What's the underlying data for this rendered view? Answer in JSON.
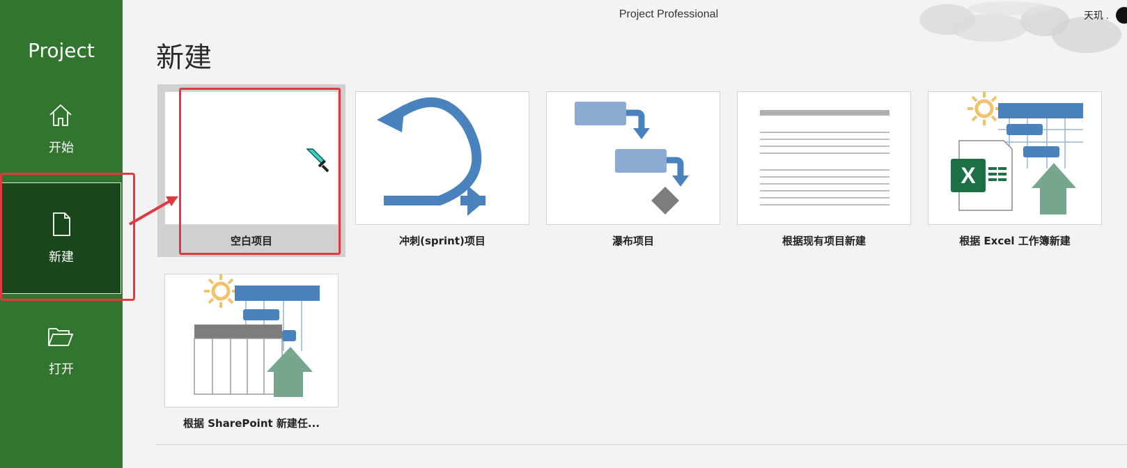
{
  "app": {
    "name": "Project",
    "window_title": "Project Professional",
    "user": "天玑 ."
  },
  "sidebar": {
    "items": [
      {
        "label": "开始",
        "icon": "home-icon"
      },
      {
        "label": "新建",
        "icon": "new-document-icon",
        "selected": true
      },
      {
        "label": "打开",
        "icon": "open-folder-icon"
      }
    ]
  },
  "page": {
    "title": "新建"
  },
  "templates": [
    {
      "label": "空白项目",
      "thumb": "blank",
      "selected": true
    },
    {
      "label": "冲刺(sprint)项目",
      "thumb": "sprint-loop"
    },
    {
      "label": "瀑布项目",
      "thumb": "waterfall"
    },
    {
      "label": "根据现有项目新建",
      "thumb": "existing-project-lines"
    },
    {
      "label": "根据 Excel 工作簿新建",
      "thumb": "excel-import"
    },
    {
      "label": "根据 SharePoint 新建任...",
      "thumb": "sharepoint-import"
    }
  ],
  "colors": {
    "sidebar": "#31752f",
    "sidebar_selected": "#19461b",
    "accent_blue": "#4a82be",
    "annotation_red": "#e0393f",
    "excel_green": "#1d7044",
    "import_arrow": "#77a68f"
  }
}
